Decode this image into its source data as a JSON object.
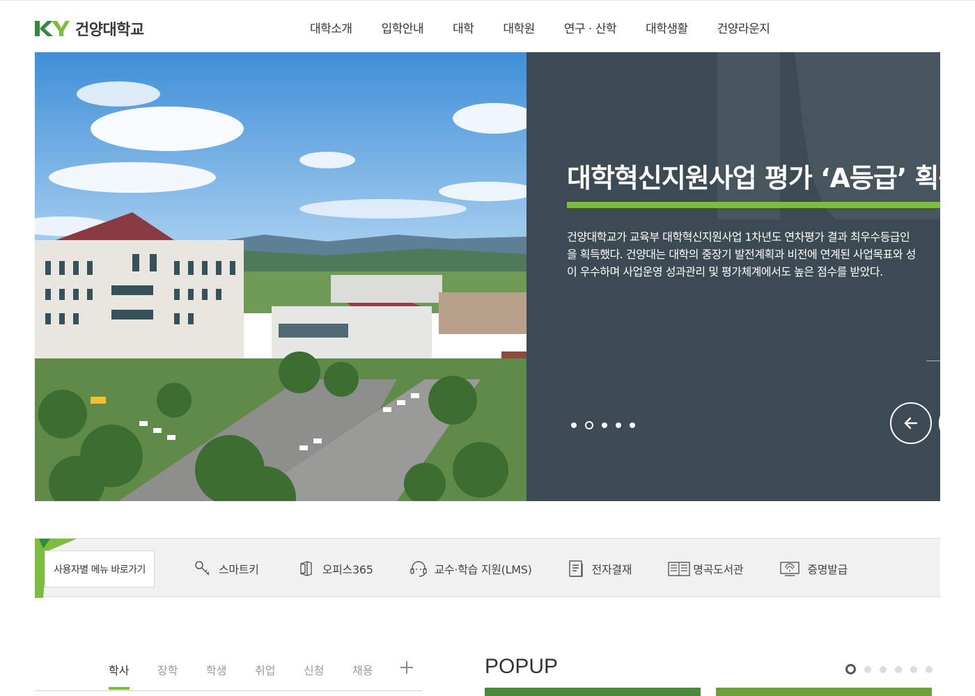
{
  "header": {
    "logo_text": "건양대학교",
    "nav": [
      "대학소개",
      "입학안내",
      "대학",
      "대학원",
      "연구 · 산학",
      "대학생활",
      "건양라운지"
    ]
  },
  "hero": {
    "title": "대학혁신지원사업 평가 ‘A등급’ 획득",
    "desc": [
      "건양대학교가 교육부 대학혁신지원사업 1차년도 연차평가 결과 최우수등급인",
      "을 획득했다. 건양대는 대학의 중장기 발전계획과 비전에 연계된 사업목표와 성",
      "이 우수하며 사업운영 성과관리 및 평가체계에서도 높은 점수를 받았다."
    ],
    "slide_count": 5,
    "active_slide": 2,
    "colors": {
      "panel": "#3b4a53",
      "accent": "#7cbd3f"
    }
  },
  "quick": {
    "menu_button": "사용자별 메뉴 바로가기",
    "items": [
      {
        "label": "스마트키",
        "icon": "key-icon"
      },
      {
        "label": "오피스365",
        "icon": "office-icon"
      },
      {
        "label": "교수·학습 지원(LMS)",
        "icon": "headset-icon"
      },
      {
        "label": "전자결재",
        "icon": "document-icon"
      },
      {
        "label": "명곡도서관",
        "icon": "library-icon"
      },
      {
        "label": "증명발급",
        "icon": "certificate-icon"
      }
    ]
  },
  "board": {
    "tabs": [
      "학사",
      "장학",
      "학생",
      "취업",
      "신청",
      "채용"
    ],
    "active_tab": "학사"
  },
  "popup": {
    "title": "POPUP",
    "count": 6,
    "active": 1
  }
}
